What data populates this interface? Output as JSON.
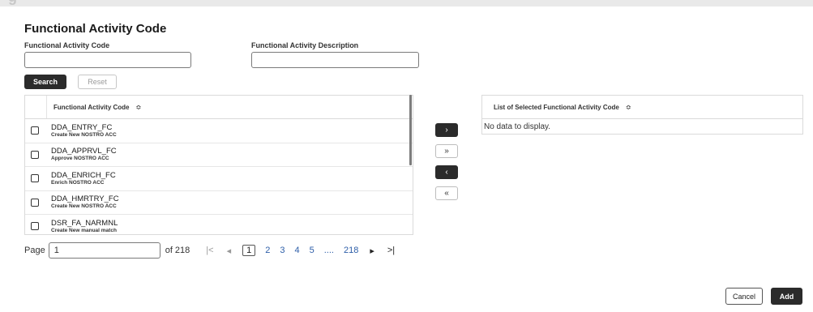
{
  "header": {
    "partial_title": "g"
  },
  "panel": {
    "title": "Functional Activity Code"
  },
  "search": {
    "code_label": "Functional Activity Code",
    "code_value": "",
    "desc_label": "Functional Activity Description",
    "desc_value": "",
    "search_label": "Search",
    "reset_label": "Reset"
  },
  "table": {
    "column_header": "Functional Activity Code",
    "sort_icon": "sort-icon",
    "rows": [
      {
        "code": "DDA_ENTRY_FC",
        "desc": "Create New NOSTRO ACC"
      },
      {
        "code": "DDA_APPRVL_FC",
        "desc": "Approve NOSTRO ACC"
      },
      {
        "code": "DDA_ENRICH_FC",
        "desc": "Enrich NOSTRO ACC"
      },
      {
        "code": "DDA_HMRTRY_FC",
        "desc": "Create New NOSTRO ACC"
      },
      {
        "code": "DSR_FA_NARMNL",
        "desc": "Create New manual match"
      }
    ]
  },
  "move_buttons": {
    "move_one": "›",
    "move_all": "»",
    "remove_one": "‹",
    "remove_all": "«"
  },
  "selected": {
    "column_header": "List of Selected Functional Activity Code",
    "empty_text": "No data to display."
  },
  "pagination": {
    "page_label": "Page",
    "page_value": "1",
    "of_label": "of 218",
    "first": "|<",
    "prev": "◂",
    "pages": [
      "1",
      "2",
      "3",
      "4",
      "5"
    ],
    "ellipsis": "....",
    "last_page": "218",
    "next": "▸",
    "last": ">|"
  },
  "footer": {
    "cancel_label": "Cancel",
    "add_label": "Add"
  }
}
